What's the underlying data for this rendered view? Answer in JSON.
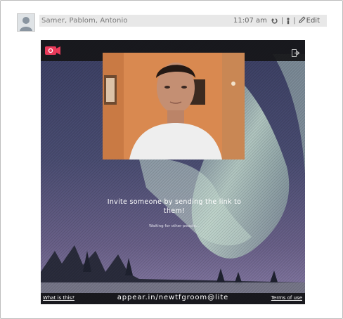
{
  "message": {
    "participants": "Samer, Pablom, Antonio",
    "time": "11:07 am",
    "separator": "|",
    "edit_label": "Edit",
    "icons": [
      "avatar",
      "reply-icon",
      "info-icon",
      "pencil-icon"
    ]
  },
  "embed": {
    "invite_text": "Invite someone by sending the link to them!",
    "waiting_text": "Waiting for other people...",
    "what_is_this": "What is this?",
    "room_url": "appear.in/newtfgroom@lite",
    "terms": "Terms of use",
    "icons": [
      "room-logo-icon",
      "leave-room-icon"
    ],
    "colors": {
      "topbar": "#161618",
      "logo_accent": "#e83a5a",
      "sky": "#3a3e66",
      "aurora": "#b9d3c8"
    }
  }
}
